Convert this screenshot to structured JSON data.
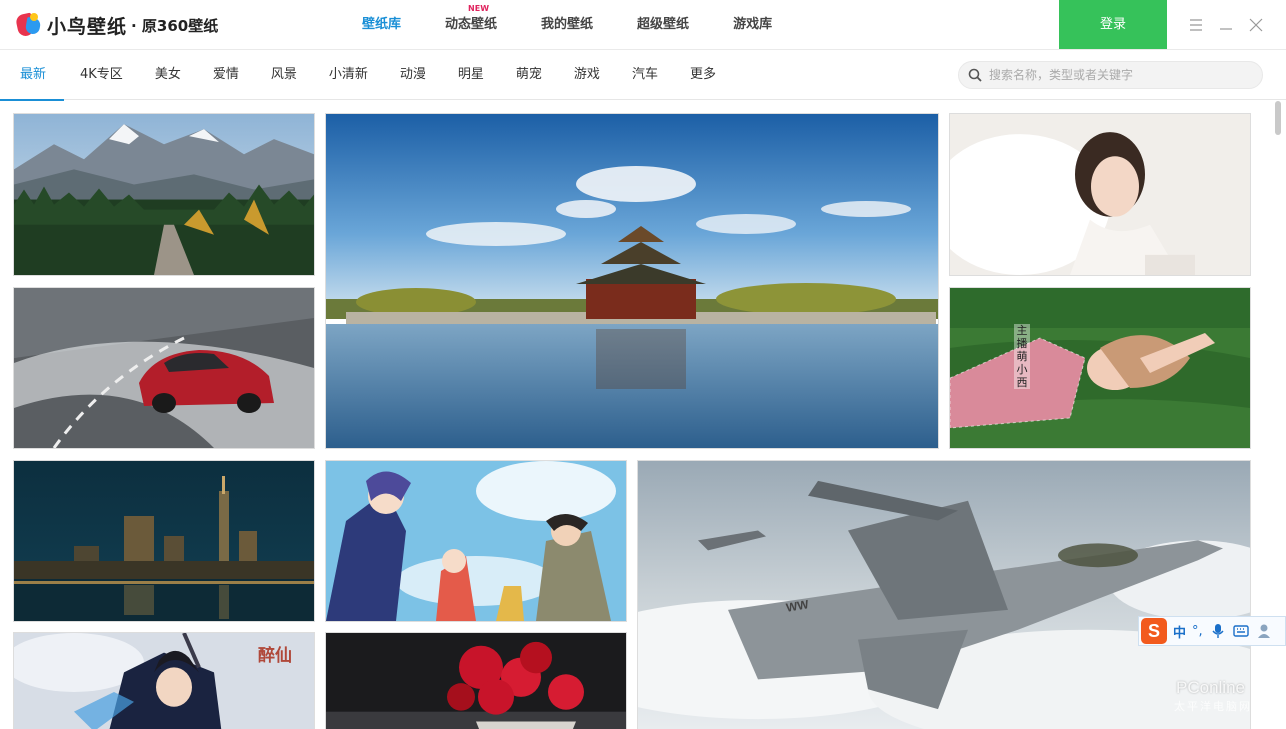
{
  "app": {
    "logo_text": "小鸟壁纸",
    "logo_sub": "· 原360壁纸"
  },
  "topnav": {
    "items": [
      {
        "label": "壁纸库",
        "active": true
      },
      {
        "label": "动态壁纸",
        "badge": "NEW"
      },
      {
        "label": "我的壁纸"
      },
      {
        "label": "超级壁纸"
      },
      {
        "label": "游戏库"
      }
    ]
  },
  "login_label": "登录",
  "categories": [
    "最新",
    "4K专区",
    "美女",
    "爱情",
    "风景",
    "小清新",
    "动漫",
    "明星",
    "萌宠",
    "游戏",
    "汽车",
    "更多"
  ],
  "search": {
    "placeholder": "搜索名称，类型或者关键字",
    "value": ""
  },
  "wallpapers": [
    {
      "subject": "mountain-forest-road"
    },
    {
      "subject": "forbidden-city-corner-tower"
    },
    {
      "subject": "woman-portrait-white"
    },
    {
      "subject": "red-sports-car"
    },
    {
      "subject": "woman-lying-on-grass",
      "caption": "主播萌小西"
    },
    {
      "subject": "city-night-skyline"
    },
    {
      "subject": "anime-characters"
    },
    {
      "subject": "fighter-jet-clouds",
      "marking": "WW"
    },
    {
      "subject": "game-character",
      "caption": "醉仙"
    },
    {
      "subject": "red-roses"
    }
  ],
  "ime": {
    "logo": "S",
    "mode": "中",
    "punct": "°,"
  },
  "watermark": {
    "main": "PConline",
    "sub": "太平洋电脑网"
  },
  "colors": {
    "accent": "#1a8fd6",
    "login": "#36c25a",
    "new_badge": "#e0245e"
  }
}
